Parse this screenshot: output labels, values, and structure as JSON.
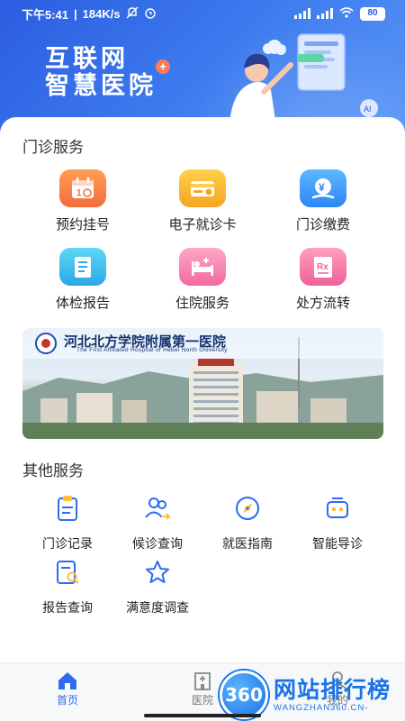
{
  "status_bar": {
    "time": "下午5:41",
    "net_speed": "184K/s",
    "battery": "80"
  },
  "hero": {
    "title_line1": "互联网",
    "title_line2": "智慧医院",
    "art_badge": "AI"
  },
  "outpatient": {
    "title": "门诊服务",
    "items": [
      {
        "label": "预约挂号",
        "icon": "calendar-icon"
      },
      {
        "label": "电子就诊卡",
        "icon": "card-icon"
      },
      {
        "label": "门诊缴费",
        "icon": "yen-payment-icon"
      },
      {
        "label": "体检报告",
        "icon": "report-icon"
      },
      {
        "label": "住院服务",
        "icon": "hospital-bed-icon"
      },
      {
        "label": "处方流转",
        "icon": "prescription-icon"
      }
    ]
  },
  "banner": {
    "title": "河北北方学院附属第一医院",
    "subtitle": "The First Affiliated Hospital of Hebei North University"
  },
  "other": {
    "title": "其他服务",
    "items": [
      {
        "label": "门诊记录",
        "icon": "clipboard-icon"
      },
      {
        "label": "候诊查询",
        "icon": "users-queue-icon"
      },
      {
        "label": "就医指南",
        "icon": "compass-icon"
      },
      {
        "label": "智能导诊",
        "icon": "robot-icon"
      },
      {
        "label": "报告查询",
        "icon": "report-search-icon"
      },
      {
        "label": "满意度调查",
        "icon": "star-icon"
      }
    ]
  },
  "bottom_nav": {
    "items": [
      {
        "label": "首页",
        "active": true
      },
      {
        "label": "医院",
        "active": false
      },
      {
        "label": "我的",
        "active": false
      }
    ]
  },
  "watermark": {
    "badge": "360",
    "title": "网站排行榜",
    "url": "WANGZHAN360.CN-"
  },
  "colors": {
    "primary": "#2b6cf0",
    "hero_gradient_start": "#2b5de0",
    "active_nav": "#2b6cf0"
  }
}
